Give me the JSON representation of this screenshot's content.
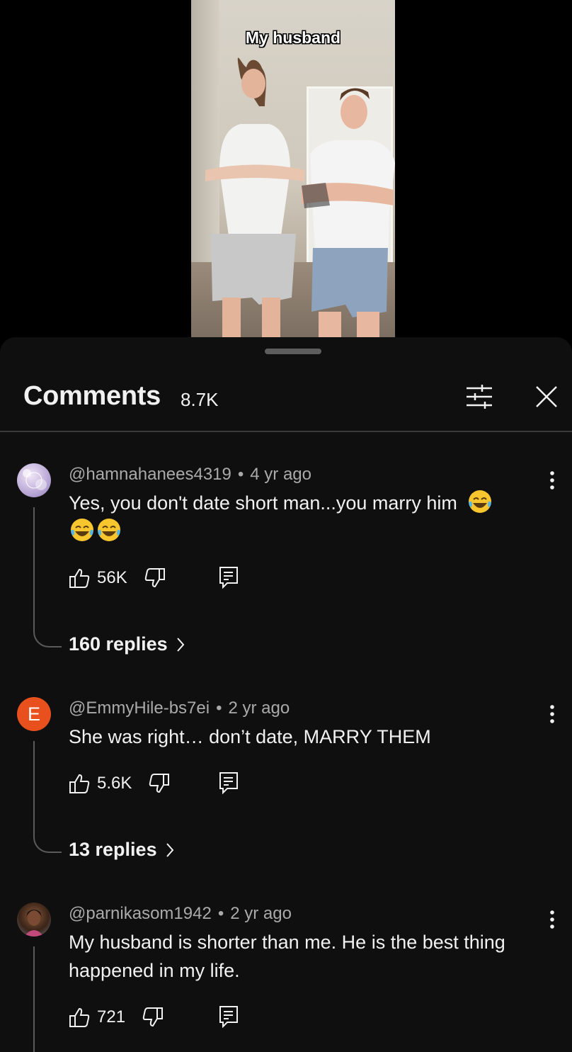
{
  "video": {
    "caption": "My husband"
  },
  "comments_panel": {
    "title": "Comments",
    "count": "8.7K",
    "filter_icon": "sliders-icon",
    "close_icon": "close-icon"
  },
  "comments": [
    {
      "author": "@hamnahanees4319",
      "separator": "•",
      "time": "4 yr ago",
      "text": "Yes, you don't date short man...you marry him",
      "emojis": [
        "😂",
        "😂",
        "😂"
      ],
      "likes": "56K",
      "replies": "160 replies",
      "avatar": "good-vibes-avatar"
    },
    {
      "author": "@EmmyHile-bs7ei",
      "separator": "•",
      "time": "2 yr ago",
      "text": "She was right… don’t date, MARRY THEM",
      "likes": "5.6K",
      "replies": "13 replies",
      "avatar_letter": "E",
      "avatar_color": "#e8501e"
    },
    {
      "author": "@parnikasom1942",
      "separator": "•",
      "time": "2 yr ago",
      "text": "My husband is shorter than me. He is the best thing happened in my life.",
      "likes": "721",
      "avatar": "photo-avatar"
    }
  ]
}
